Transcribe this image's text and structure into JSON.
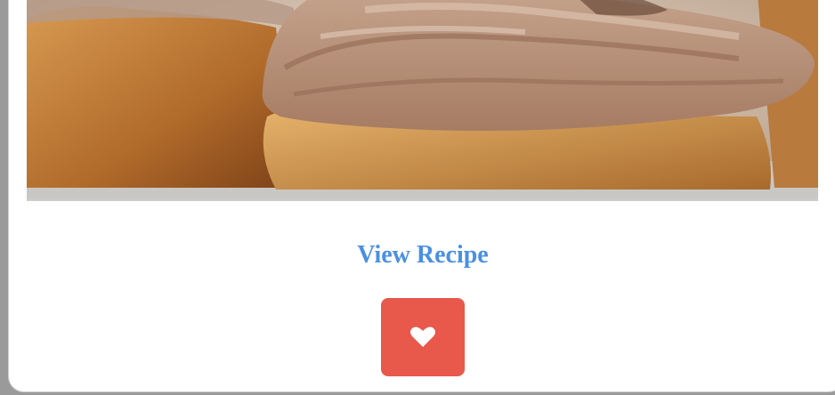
{
  "card": {
    "image_alt": "Cupcake with chocolate frosting",
    "link_label": "View Recipe",
    "link_color": "#4a90e2"
  },
  "favorite_button": {
    "icon": "heart-icon",
    "color": "#e8584b"
  }
}
